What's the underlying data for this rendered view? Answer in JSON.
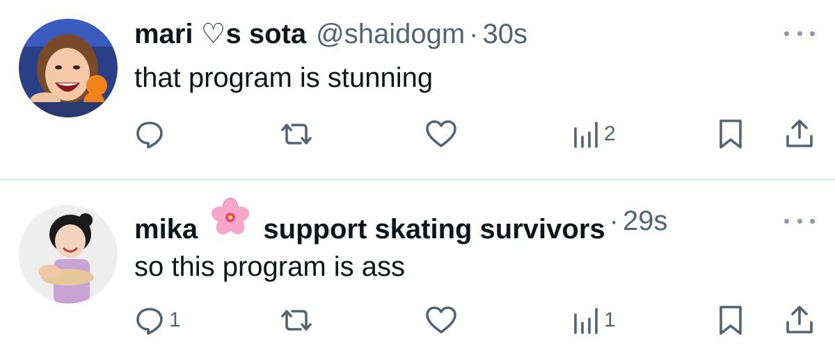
{
  "tweets": [
    {
      "name_part1": "mari",
      "heart_symbol": "♡",
      "name_part2": "s sota",
      "handle": "@shaidogm",
      "separator": "·",
      "time": "30s",
      "text": "that program is stunning",
      "reply_count": "",
      "views_count": "2"
    },
    {
      "name_part1": "mika",
      "emoji": "cherry-blossom",
      "name_part2": "support skating survivors",
      "separator": "·",
      "time": "29s",
      "text": "so this program is ass",
      "reply_count": "1",
      "views_count": "1"
    }
  ],
  "icons": {
    "reply": "reply-icon",
    "retweet": "retweet-icon",
    "like": "like-icon",
    "views": "views-icon",
    "bookmark": "bookmark-icon",
    "share": "share-icon",
    "more": "more-icon"
  },
  "colors": {
    "text": "#0f1419",
    "secondary": "#536471",
    "divider": "#e6e9eb"
  }
}
